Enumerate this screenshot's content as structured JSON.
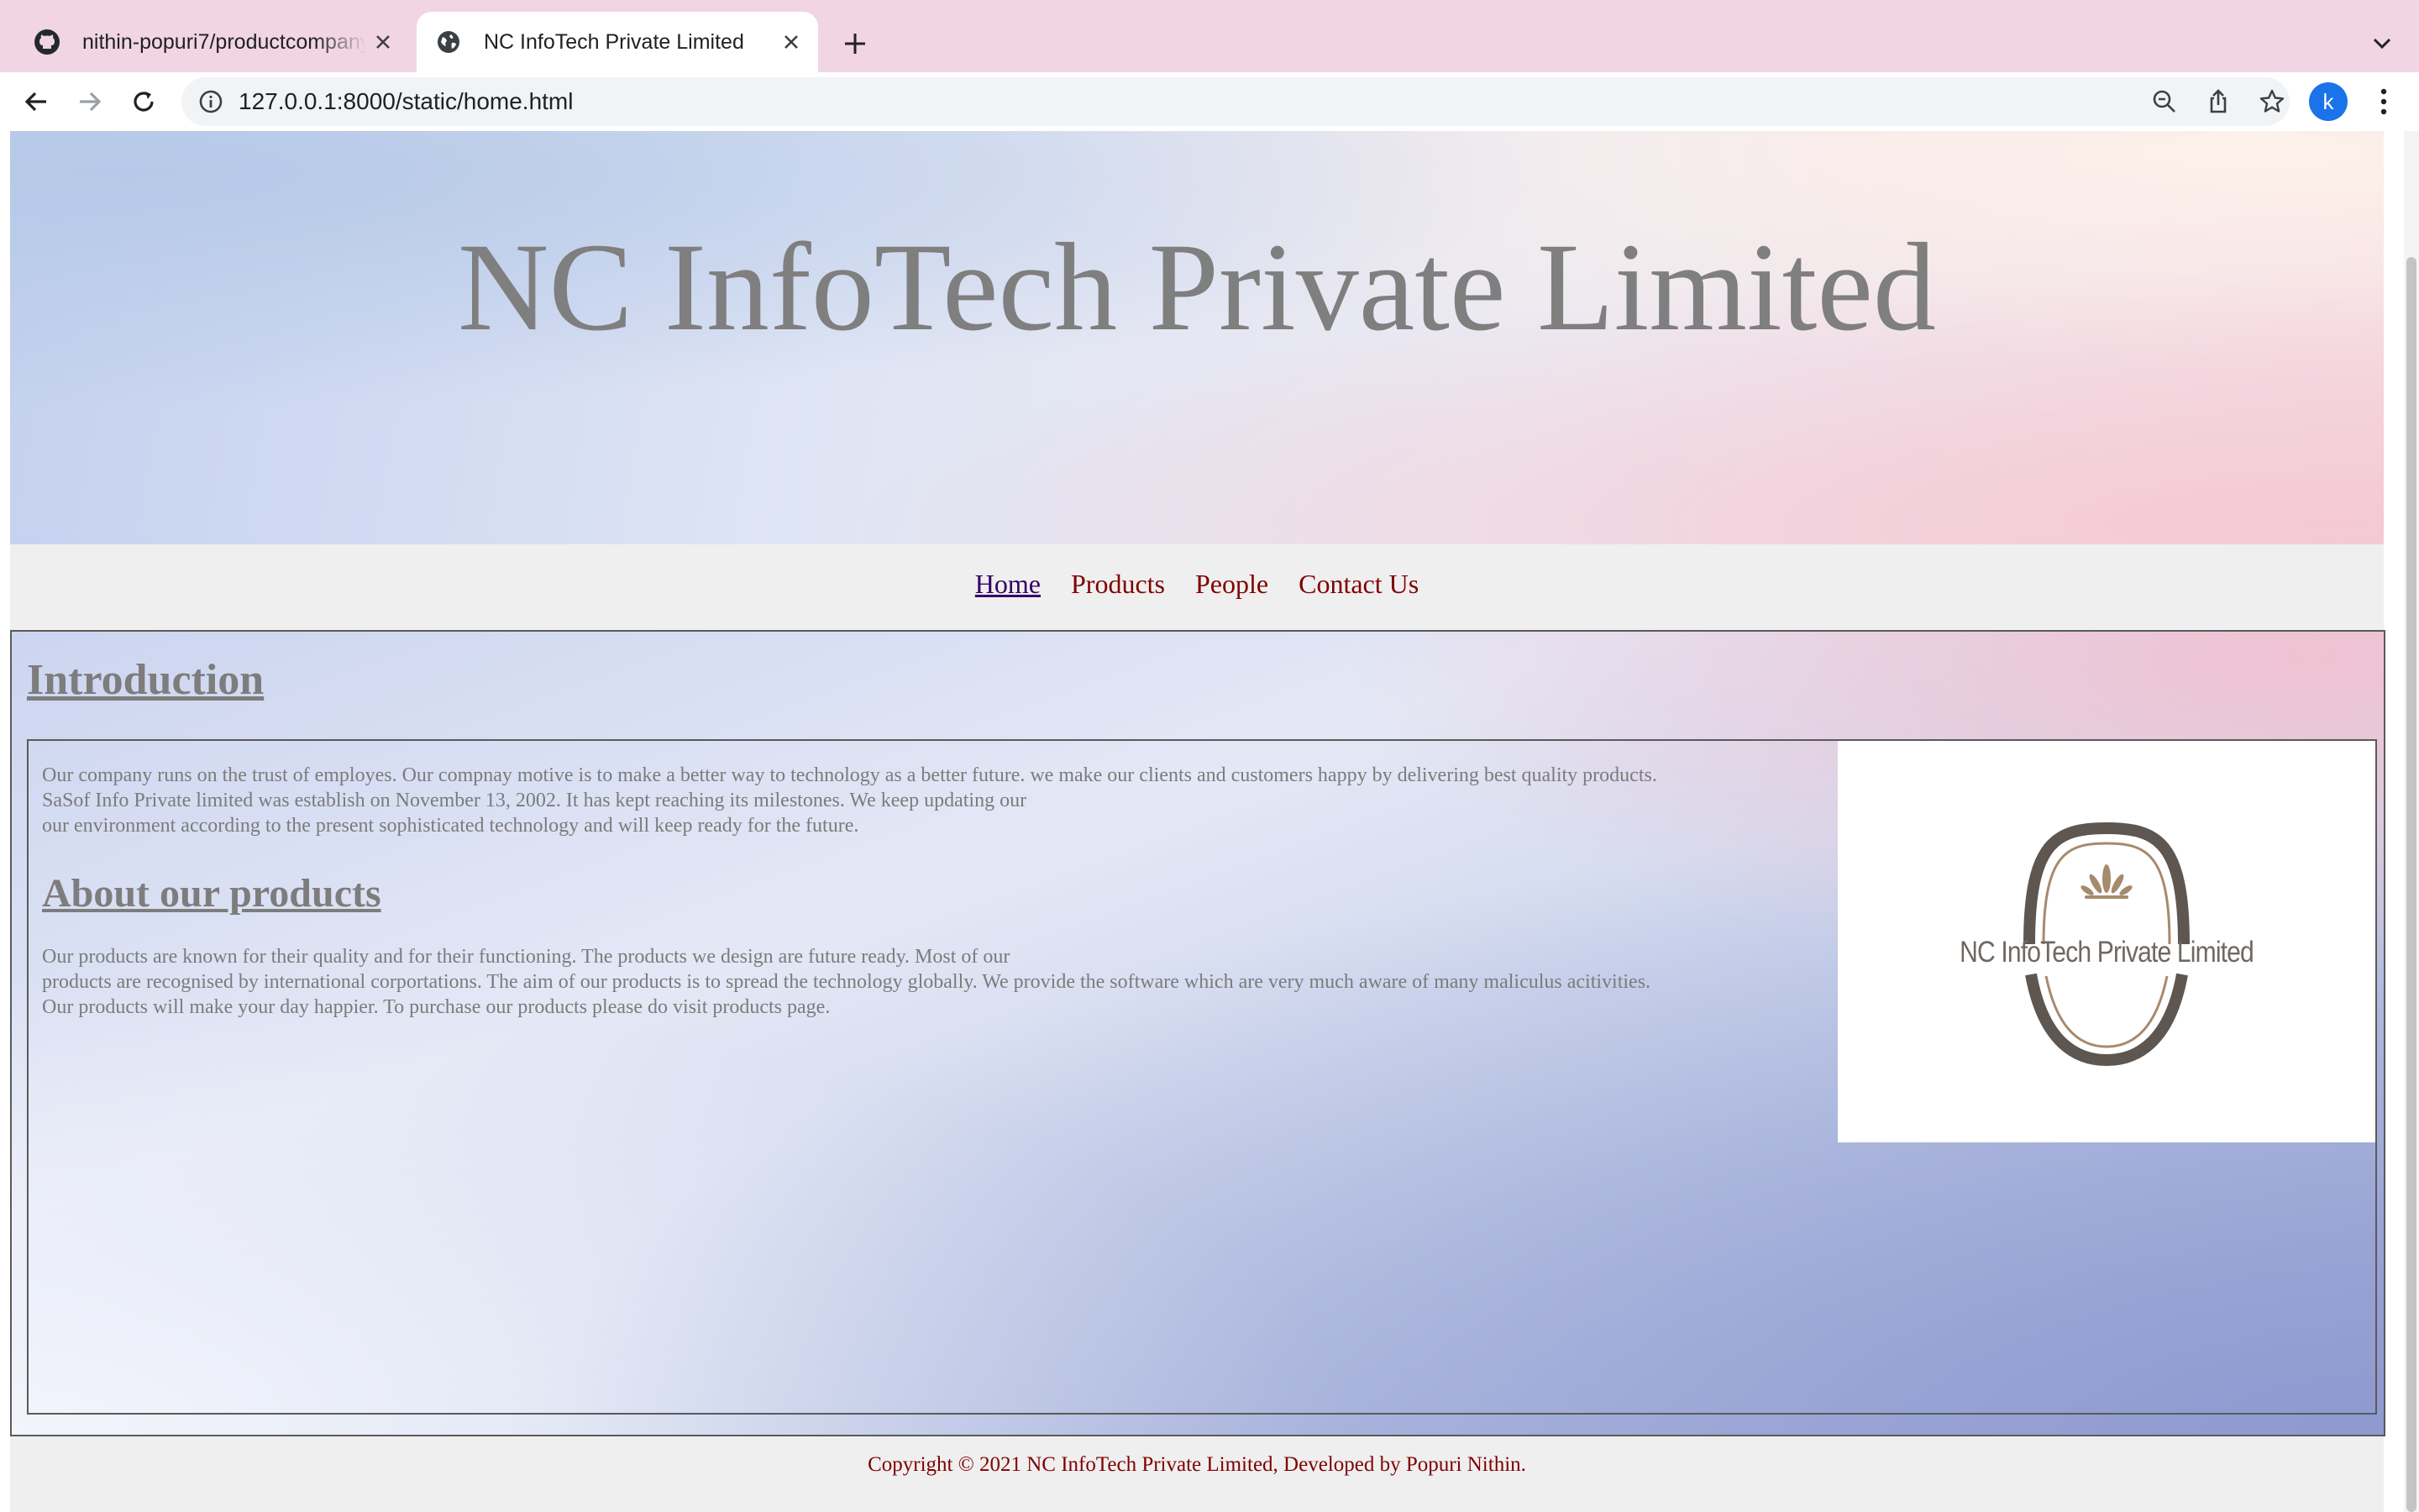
{
  "browser": {
    "tabs": [
      {
        "title": "nithin-popuri7/productcompany",
        "favicon": "github-icon",
        "active": false
      },
      {
        "title": "NC InfoTech Private Limited",
        "favicon": "globe-icon",
        "active": true
      }
    ],
    "url": "127.0.0.1:8000/static/home.html",
    "profile_initial": "k",
    "accent_color": "#1a73e8",
    "tabbar_color": "#f1d5e3"
  },
  "site": {
    "title": "NC InfoTech Private Limited",
    "nav": [
      {
        "label": "Home",
        "current": true
      },
      {
        "label": "Products",
        "current": false
      },
      {
        "label": "People",
        "current": false
      },
      {
        "label": "Contact Us",
        "current": false
      }
    ],
    "intro_heading": "Introduction",
    "intro_lines": [
      "Our company runs on the trust of employes. Our compnay motive is to make a better way to technology as a better future. we make our clients and customers happy by delivering best quality products.",
      "SaSof Info Private limited was establish on November 13, 2002. It has kept reaching its milestones. We keep updating our",
      "our environment according to the present sophisticated technology and will keep ready for the future."
    ],
    "products_heading": "About our products",
    "products_lines": [
      "Our products are known for their quality and for their functioning. The products we design are future ready. Most of our",
      "products are recognised by international corportations. The aim of our products is to spread the technology globally. We provide the software which are very much aware of many maliculus acitivities.",
      "Our products will make your day happier. To purchase our products please do visit products page."
    ],
    "logo_text": "NC InfoTech Private Limited",
    "footer": "Copyright © 2021 NC InfoTech Private Limited, Developed by Popuri Nithin.",
    "link_color": "#800000",
    "visited_link_color": "#330066"
  }
}
